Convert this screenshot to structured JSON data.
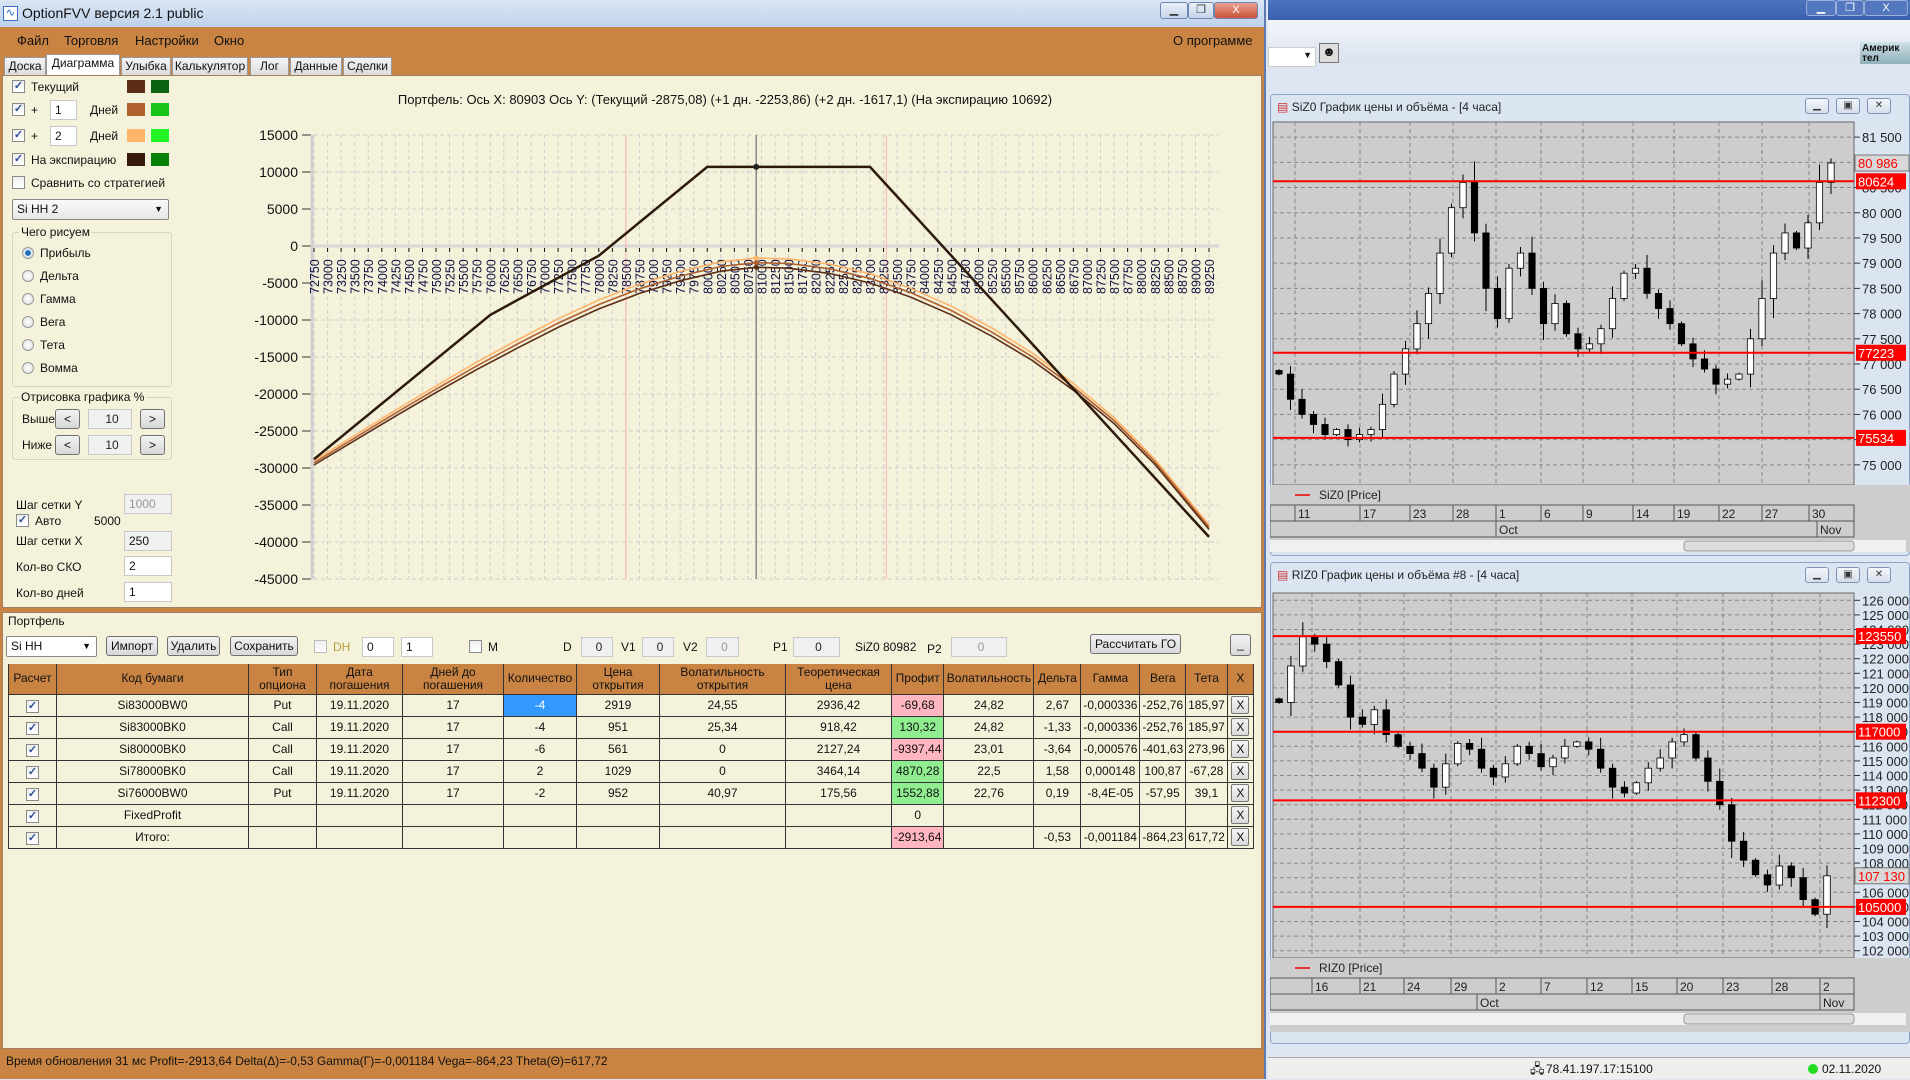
{
  "window": {
    "title": "OptionFVV версия 2.1 public",
    "min": "▁",
    "max": "❐",
    "close": "X"
  },
  "menu": {
    "items": [
      "Файл",
      "Торговля",
      "Настройки",
      "Окно"
    ],
    "about": "О программе"
  },
  "tabs": [
    "Доска",
    "Диаграмма",
    "Улыбка",
    "Калькулятор",
    "Лог",
    "Данные",
    "Сделки"
  ],
  "active_tab": "Диаграмма",
  "diagram_controls": {
    "rows": [
      {
        "label": "Текущий",
        "checked": true,
        "colors": [
          "#5c2e16",
          "#0b6312"
        ]
      },
      {
        "prefix": "+",
        "days": "1",
        "unit": "Дней",
        "checked": true,
        "colors": [
          "#b0602e",
          "#18c418"
        ]
      },
      {
        "prefix": "+",
        "days": "2",
        "unit": "Дней",
        "checked": true,
        "colors": [
          "#ffb469",
          "#23f423"
        ]
      },
      {
        "label": "На экспирацию",
        "checked": true,
        "colors": [
          "#361a0a",
          "#078207"
        ]
      }
    ],
    "compare_label": "Сравнить со стратегией",
    "strategy_select": "Si HH 2",
    "draw_group": {
      "title": "Чего рисуем",
      "options": [
        "Прибыль",
        "Дельта",
        "Гамма",
        "Вега",
        "Тета",
        "Вомма"
      ],
      "selected": "Прибыль"
    },
    "range_group": {
      "title": "Отрисовка графика %",
      "above_label": "Выше",
      "above_value": "10",
      "below_label": "Ниже",
      "below_value": "10",
      "dec": "<",
      "inc": ">"
    },
    "grid_y_label": "Шаг сетки Y",
    "grid_y_value": "1000",
    "auto_label": "Авто",
    "auto_value": "5000",
    "grid_x_label": "Шаг сетки X",
    "grid_x_value": "250",
    "sko_label": "Кол-во СКО",
    "sko_value": "2",
    "days_label": "Кол-во дней",
    "days_value": "1"
  },
  "chart_header": "Портфель: Ось X: 80903 Ось Y:  (Текущий -2875,08)  (+1 дн. -2253,86)  (+2 дн. -1617,1)  (На экспирацию 10692)",
  "chart_data": [
    {
      "type": "line",
      "xlim": [
        72750,
        89250
      ],
      "ylim": [
        -45000,
        15000
      ],
      "grid": true,
      "ytick_labels": [
        "15000",
        "10000",
        "5000",
        "0",
        "-5000",
        "-10000",
        "-15000",
        "-20000",
        "-25000",
        "-30000",
        "-35000",
        "-40000",
        "-45000"
      ],
      "xtick_labels": [
        72750,
        73000,
        73250,
        73500,
        73750,
        74000,
        74250,
        74500,
        74750,
        75000,
        75250,
        75500,
        75750,
        76000,
        76250,
        76500,
        76750,
        77000,
        77250,
        77500,
        77750,
        78000,
        78250,
        78500,
        78750,
        79000,
        79250,
        79500,
        79750,
        80000,
        80250,
        80500,
        80750,
        81000,
        81250,
        81500,
        81750,
        82000,
        82250,
        82500,
        82750,
        83000,
        83250,
        83500,
        83750,
        84000,
        84250,
        84500,
        84750,
        85000,
        85250,
        85500,
        85750,
        86000,
        86250,
        86500,
        86750,
        87000,
        87250,
        87500,
        87750,
        88000,
        88250,
        88500,
        88750,
        89000,
        89250
      ],
      "cursor_x": 80903,
      "sd_lines": [
        78500,
        83300
      ],
      "x": [
        72750,
        73500,
        74250,
        75000,
        75750,
        76500,
        77250,
        78000,
        78750,
        79500,
        80250,
        80903,
        81500,
        82250,
        83000,
        83750,
        84500,
        85250,
        86000,
        86750,
        87500,
        88250,
        89250
      ],
      "series": [
        {
          "key": "current",
          "color": "#5c2e16",
          "values": [
            -29600,
            -26300,
            -23000,
            -19800,
            -16700,
            -13800,
            -11000,
            -8500,
            -6400,
            -4700,
            -3400,
            -2875,
            -3000,
            -3700,
            -5000,
            -6900,
            -9300,
            -12200,
            -15500,
            -19500,
            -24000,
            -29500,
            -38300
          ]
        },
        {
          "key": "plus1",
          "color": "#b0602e",
          "values": [
            -29300,
            -25950,
            -22600,
            -19350,
            -16200,
            -13250,
            -10420,
            -7900,
            -5780,
            -4070,
            -2770,
            -2254,
            -2370,
            -3070,
            -4380,
            -6300,
            -8720,
            -11650,
            -15000,
            -19050,
            -23600,
            -29150,
            -38000
          ]
        },
        {
          "key": "plus2",
          "color": "#ffb469",
          "values": [
            -29000,
            -25600,
            -22200,
            -18900,
            -15700,
            -12700,
            -9840,
            -7300,
            -5160,
            -3440,
            -2140,
            -1617,
            -1740,
            -2440,
            -3760,
            -5700,
            -8140,
            -11100,
            -14500,
            -18600,
            -23200,
            -28800,
            -37700
          ]
        }
      ],
      "expiration": {
        "color": "#2e1a0c",
        "x": [
          72750,
          76000,
          78000,
          80000,
          83000,
          89250
        ],
        "y": [
          -28808,
          -9308,
          -1308,
          10692,
          10692,
          -39308
        ]
      }
    },
    {
      "type": "candlestick",
      "ylim": [
        74600,
        81800
      ],
      "ytick_labels": [
        "81 500",
        "81 000",
        "80 500",
        "80 000",
        "79 500",
        "79 000",
        "78 500",
        "78 000",
        "77 500",
        "77 000",
        "76 500",
        "76 000",
        "75 500",
        "75 000"
      ],
      "ytick_values": [
        81500,
        81000,
        80500,
        80000,
        79500,
        79000,
        78500,
        78000,
        77500,
        77000,
        76500,
        76000,
        75500,
        75000
      ],
      "levels": [
        {
          "value": 80624,
          "label": "80624"
        },
        {
          "value": 77223,
          "label": "77223"
        },
        {
          "value": 75534,
          "label": "75534"
        }
      ],
      "last": {
        "value": 80986,
        "label": "80 986"
      },
      "legend": "SiZ0 [Price]",
      "date_labels": [
        "11",
        "17",
        "23",
        "28",
        "1",
        "6",
        "9",
        "14",
        "19",
        "22",
        "27",
        "30"
      ],
      "months": [
        "Oct",
        "Nov"
      ],
      "close": [
        76800,
        76300,
        76000,
        75800,
        75600,
        75700,
        75500,
        75600,
        75700,
        76200,
        76800,
        77300,
        77800,
        78400,
        79200,
        80100,
        80600,
        79600,
        78500,
        77900,
        78900,
        79200,
        78500,
        77800,
        78200,
        77600,
        77300,
        77400,
        77700,
        78300,
        78800,
        78900,
        78400,
        78100,
        77800,
        77400,
        77100,
        76900,
        76600,
        76700,
        76800,
        77500,
        78300,
        79200,
        79600,
        79300,
        79800,
        80600,
        80986
      ]
    },
    {
      "type": "candlestick",
      "ylim": [
        101500,
        126500
      ],
      "ytick_labels": [
        "126 000",
        "125 000",
        "124 000",
        "123 000",
        "122 000",
        "121 000",
        "120 000",
        "119 000",
        "118 000",
        "117 000",
        "116 000",
        "115 000",
        "114 000",
        "113 000",
        "112 000",
        "111 000",
        "110 000",
        "109 000",
        "108 000",
        "107 000",
        "106 000",
        "105 000",
        "104 000",
        "103 000",
        "102 000"
      ],
      "ytick_values": [
        126000,
        125000,
        124000,
        123000,
        122000,
        121000,
        120000,
        119000,
        118000,
        117000,
        116000,
        115000,
        114000,
        113000,
        112000,
        111000,
        110000,
        109000,
        108000,
        107000,
        106000,
        105000,
        104000,
        103000,
        102000
      ],
      "levels": [
        {
          "value": 123550,
          "label": "123550"
        },
        {
          "value": 117000,
          "label": "117000"
        },
        {
          "value": 112300,
          "label": "112300"
        },
        {
          "value": 105000,
          "label": "105000"
        }
      ],
      "last": {
        "value": 107130,
        "label": "107 130"
      },
      "legend": "RIZ0 [Price]",
      "date_labels": [
        "16",
        "21",
        "24",
        "29",
        "2",
        "7",
        "12",
        "15",
        "20",
        "23",
        "28",
        "2"
      ],
      "months": [
        "Oct",
        "Nov"
      ],
      "close": [
        119000,
        121500,
        123500,
        123000,
        121800,
        120200,
        118000,
        117500,
        118500,
        116800,
        116000,
        115500,
        114500,
        113200,
        114800,
        116200,
        115800,
        114500,
        113900,
        114800,
        116000,
        115500,
        114600,
        115200,
        116000,
        116300,
        115800,
        114500,
        113200,
        112800,
        113500,
        114500,
        115200,
        116300,
        116800,
        115200,
        113600,
        112000,
        109500,
        108200,
        107200,
        106500,
        107800,
        107000,
        105500,
        104500,
        107130
      ]
    }
  ],
  "portfolio": {
    "title": "Портфель",
    "select": "Si HH",
    "import": "Импорт",
    "delete": "Удалить",
    "save": "Сохранить",
    "dh_label": "DH",
    "spin1": "0",
    "spin2": "1",
    "m_label": "M",
    "d_label": "D",
    "d_value": "0",
    "v1_label": "V1",
    "v1_value": "0",
    "v2_label": "V2",
    "v2_value": "0",
    "p1_label": "P1",
    "p1_value": "0",
    "ticker_price": "SiZ0 80982",
    "p2_label": "P2",
    "p2_value": "0",
    "calc_go": "Рассчитать ГО",
    "minimize": "_",
    "headers": [
      "Расчет",
      "Код бумаги",
      "Тип\nопциона",
      "Дата\nпогашения",
      "Дней до\nпогашения",
      "Количество",
      "Цена\nоткрытия",
      "Волатильность\nоткрытия",
      "Теоретическая\nцена",
      "Профит",
      "Волатильность",
      "Дельта",
      "Гамма",
      "Вега",
      "Тета",
      "X"
    ],
    "rows": [
      {
        "cells": [
          "Si83000BW0",
          "Put",
          "19.11.2020",
          "17",
          "-4",
          "2919",
          "24,55",
          "2936,42",
          "-69,68",
          "24,82",
          "2,67",
          "-0,000336",
          "-252,76",
          "185,97"
        ],
        "profit": "neg",
        "selected_qty": true
      },
      {
        "cells": [
          "Si83000BK0",
          "Call",
          "19.11.2020",
          "17",
          "-4",
          "951",
          "25,34",
          "918,42",
          "130,32",
          "24,82",
          "-1,33",
          "-0,000336",
          "-252,76",
          "185,97"
        ],
        "profit": "pos"
      },
      {
        "cells": [
          "Si80000BK0",
          "Call",
          "19.11.2020",
          "17",
          "-6",
          "561",
          "0",
          "2127,24",
          "-9397,44",
          "23,01",
          "-3,64",
          "-0,000576",
          "-401,63",
          "273,96"
        ],
        "profit": "neg"
      },
      {
        "cells": [
          "Si78000BK0",
          "Call",
          "19.11.2020",
          "17",
          "2",
          "1029",
          "0",
          "3464,14",
          "4870,28",
          "22,5",
          "1,58",
          "0,000148",
          "100,87",
          "-67,28"
        ],
        "profit": "pos"
      },
      {
        "cells": [
          "Si76000BW0",
          "Put",
          "19.11.2020",
          "17",
          "-2",
          "952",
          "40,97",
          "175,56",
          "1552,88",
          "22,76",
          "0,19",
          "-8,4E-05",
          "-57,95",
          "39,1"
        ],
        "profit": "pos"
      },
      {
        "cells": [
          "FixedProfit",
          "",
          "",
          "",
          "",
          "",
          "",
          "",
          "0",
          "",
          "",
          "",
          "",
          ""
        ],
        "profit": ""
      },
      {
        "cells": [
          "Итого:",
          "",
          "",
          "",
          "",
          "",
          "",
          "",
          "-2913,64",
          "",
          "-0,53",
          "-0,001184",
          "-864,23",
          "617,72"
        ],
        "profit": "neg"
      }
    ],
    "delete_row": "X"
  },
  "status_bar": "Время обновления 31 мс  Profit=-2913,64 Delta(Δ)=-0,53 Gamma(Γ)=-0,001184 Vega=-864,23 Theta(Θ)=617,72",
  "right": {
    "banner": "Америк тел",
    "chart1_title": "SiZ0 График цены и объёма - [4 часа]",
    "chart2_title": "RIZ0 График цены и объёма #8 - [4 часа]",
    "server": "78.41.197.17:15100",
    "date": "02.11.2020",
    "status_color": "#22dd22",
    "level_color": "#ff0000"
  }
}
